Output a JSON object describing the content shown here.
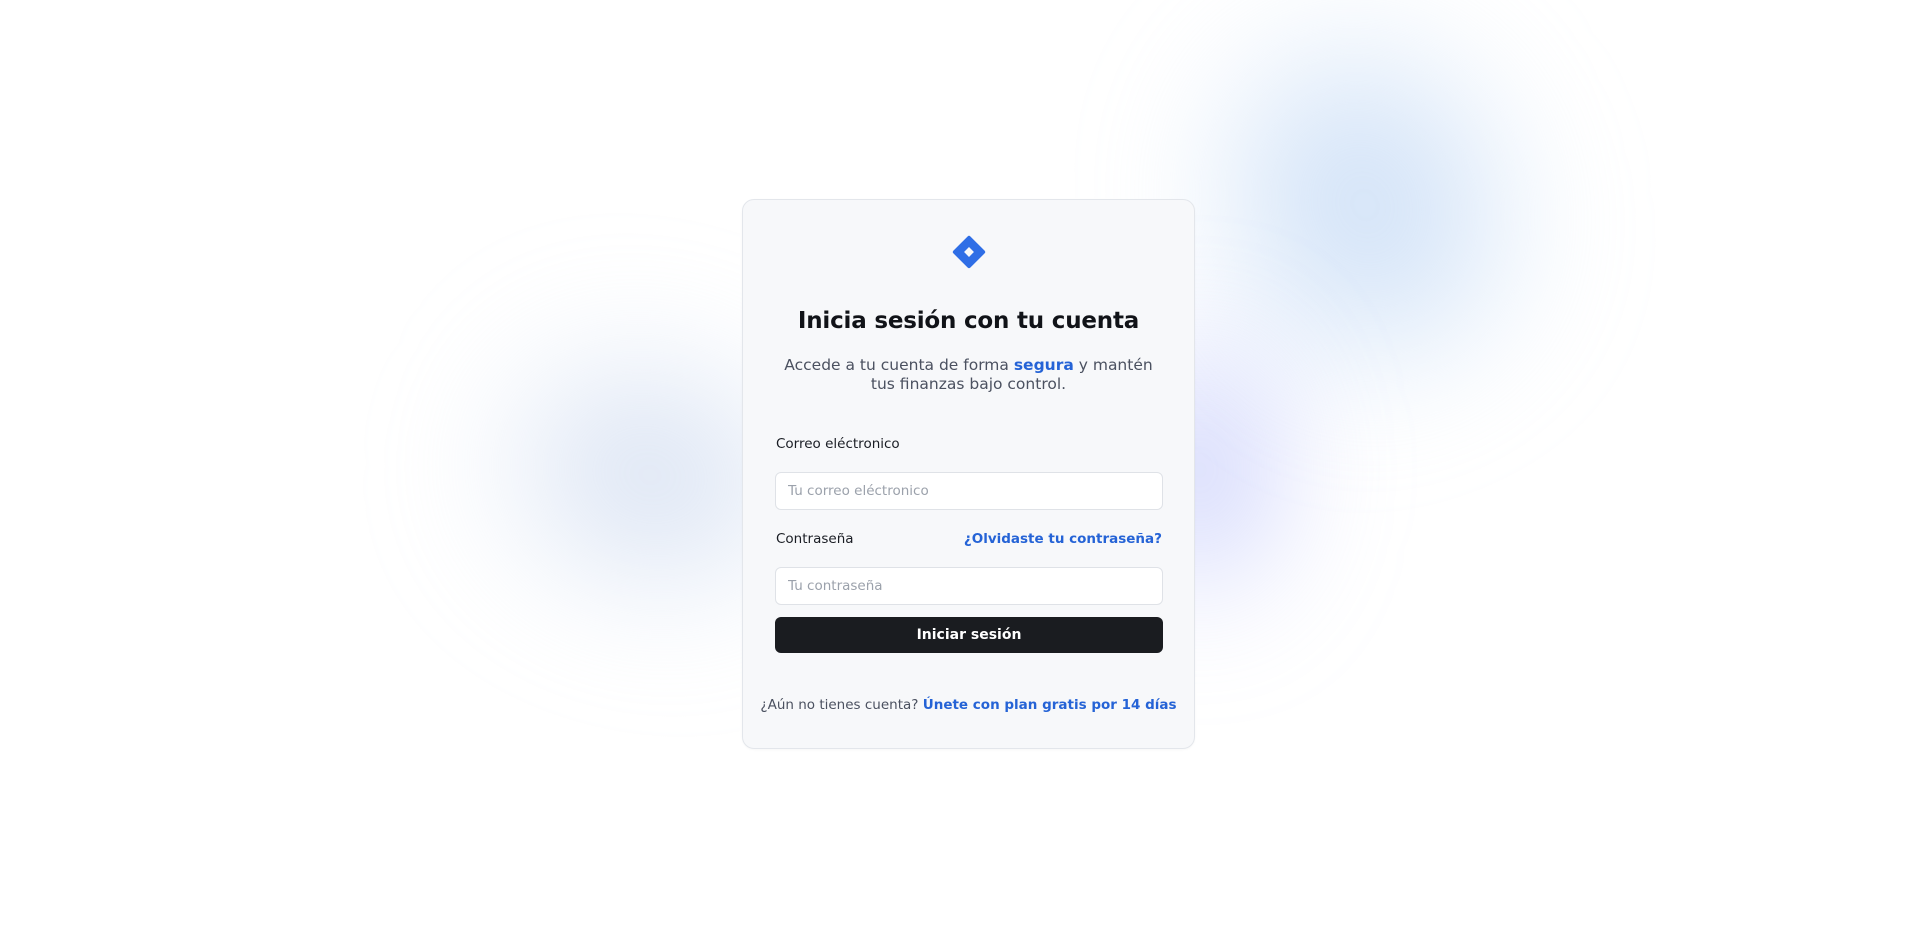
{
  "colors": {
    "accent": "#2563d6",
    "logo": "#2f6ee6",
    "button_bg": "#1a1c20",
    "card_bg": "#f7f8fa"
  },
  "logo": {
    "icon": "diamond-logo-icon"
  },
  "title": "Inicia sesión con tu cuenta",
  "subtitle": {
    "before": "Accede a tu cuenta de forma ",
    "accent": "segura",
    "after": " y mantén tus finanzas bajo control."
  },
  "form": {
    "email": {
      "label": "Correo eléctronico",
      "placeholder": "Tu correo eléctronico",
      "value": ""
    },
    "password": {
      "label": "Contraseña",
      "placeholder": "Tu contraseña",
      "value": "",
      "forgot_link": "¿Olvidaste tu contraseña?"
    },
    "submit_label": "Iniciar sesión"
  },
  "footer": {
    "prompt": "¿Aún no tienes cuenta?",
    "link": "Únete con plan gratis por 14 días"
  }
}
